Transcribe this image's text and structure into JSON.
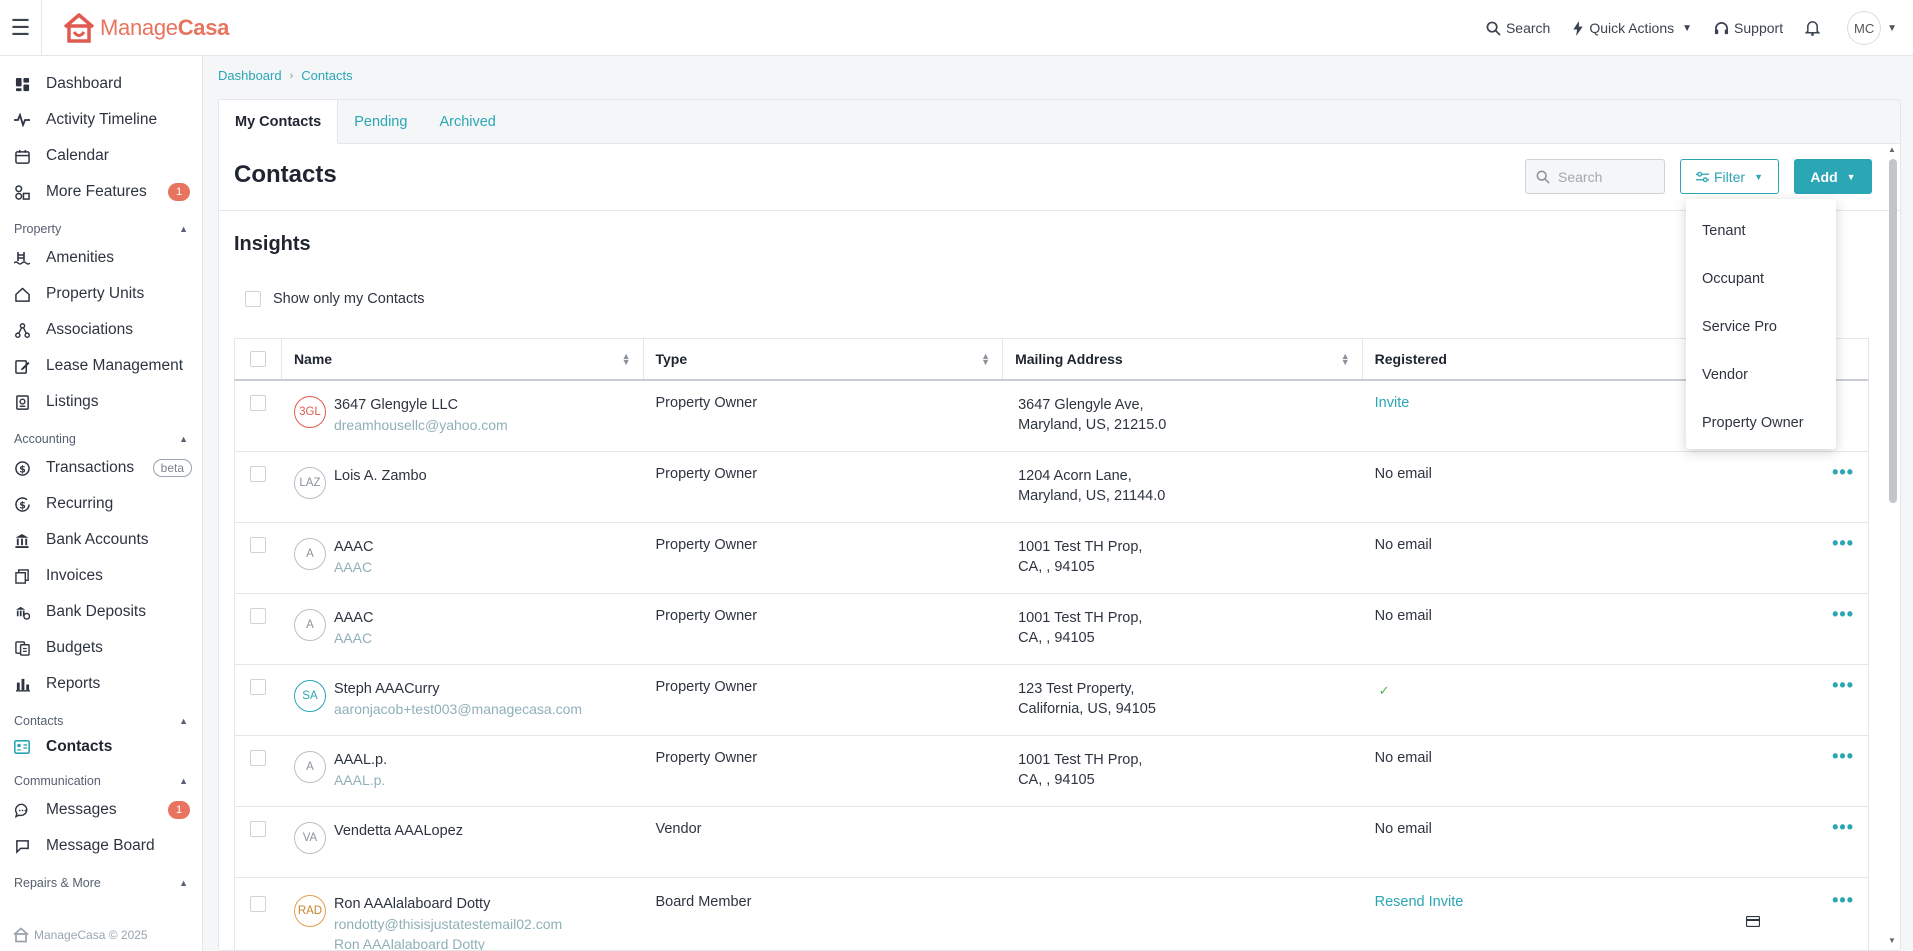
{
  "topbar": {
    "logo_manage": "Manage",
    "logo_casa": "Casa",
    "search_label": "Search",
    "quick_actions_label": "Quick Actions",
    "support_label": "Support",
    "user_initials": "MC"
  },
  "sidebar": {
    "top_items": [
      {
        "label": "Dashboard"
      },
      {
        "label": "Activity Timeline"
      },
      {
        "label": "Calendar"
      },
      {
        "label": "More Features",
        "badge": "1"
      }
    ],
    "sections": {
      "property": "Property",
      "accounting": "Accounting",
      "contacts": "Contacts",
      "communication": "Communication",
      "repairs": "Repairs & More"
    },
    "property_items": [
      "Amenities",
      "Property Units",
      "Associations",
      "Lease Management",
      "Listings"
    ],
    "accounting_items": [
      {
        "label": "Transactions",
        "tag": "beta"
      },
      {
        "label": "Recurring"
      },
      {
        "label": "Bank Accounts"
      },
      {
        "label": "Invoices"
      },
      {
        "label": "Bank Deposits"
      },
      {
        "label": "Budgets"
      },
      {
        "label": "Reports"
      }
    ],
    "contacts_items": [
      "Contacts"
    ],
    "communication_items": [
      {
        "label": "Messages",
        "badge": "1"
      },
      {
        "label": "Message Board"
      }
    ],
    "footer": "ManageCasa © 2025"
  },
  "breadcrumb": {
    "home": "Dashboard",
    "current": "Contacts"
  },
  "tabs": [
    "My Contacts",
    "Pending",
    "Archived"
  ],
  "page": {
    "title": "Contacts",
    "search_placeholder": "Search",
    "filter_label": "Filter",
    "add_label": "Add",
    "insights_title": "Insights",
    "show_only_label": "Show only my Contacts"
  },
  "table": {
    "headers": {
      "name": "Name",
      "type": "Type",
      "address": "Mailing Address",
      "registered": "Registered"
    },
    "rows": [
      {
        "initials": "3GL",
        "name": "3647 Glengyle LLC",
        "sub": "dreamhousellc@yahoo.com",
        "type": "Property Owner",
        "addr1": "3647 Glengyle Ave,",
        "addr2": "Maryland, US, 21215.0",
        "registered": "Invite"
      },
      {
        "initials": "LAZ",
        "name": "Lois A. Zambo",
        "sub": "",
        "type": "Property Owner",
        "addr1": "1204 Acorn Lane,",
        "addr2": "Maryland, US, 21144.0",
        "registered": "No email"
      },
      {
        "initials": "A",
        "name": "AAAC",
        "sub": "AAAC",
        "type": "Property Owner",
        "addr1": "1001 Test TH Prop,",
        "addr2": "CA, , 94105",
        "registered": "No email"
      },
      {
        "initials": "A",
        "name": "AAAC",
        "sub": "AAAC",
        "type": "Property Owner",
        "addr1": "1001 Test TH Prop,",
        "addr2": "CA, , 94105",
        "registered": "No email"
      },
      {
        "initials": "SA",
        "name": "Steph AAACurry",
        "sub": "aaronjacob+test003@managecasa.com",
        "type": "Property Owner",
        "addr1": "123 Test Property,",
        "addr2": "California, US, 94105",
        "registered": "✓"
      },
      {
        "initials": "A",
        "name": "AAAL.p.",
        "sub": "AAAL.p.",
        "type": "Property Owner",
        "addr1": "1001 Test TH Prop,",
        "addr2": "CA, , 94105",
        "registered": "No email"
      },
      {
        "initials": "VA",
        "name": "Vendetta AAALopez",
        "sub": "",
        "type": "Vendor",
        "addr1": "",
        "addr2": "",
        "registered": "No email"
      },
      {
        "initials": "RAD",
        "name": "Ron AAAlalaboard Dotty",
        "sub": "rondotty@thisisjustatestemail02.com",
        "sub2": "Ron AAAlalaboard Dotty",
        "type": "Board Member",
        "addr1": "",
        "addr2": "",
        "registered": "Resend Invite"
      }
    ]
  },
  "add_menu": [
    "Tenant",
    "Occupant",
    "Service Pro",
    "Vendor",
    "Property Owner"
  ],
  "colors": {
    "accent": "#2ba6b5",
    "brand": "#e8735f",
    "badge": "#e8735f"
  }
}
